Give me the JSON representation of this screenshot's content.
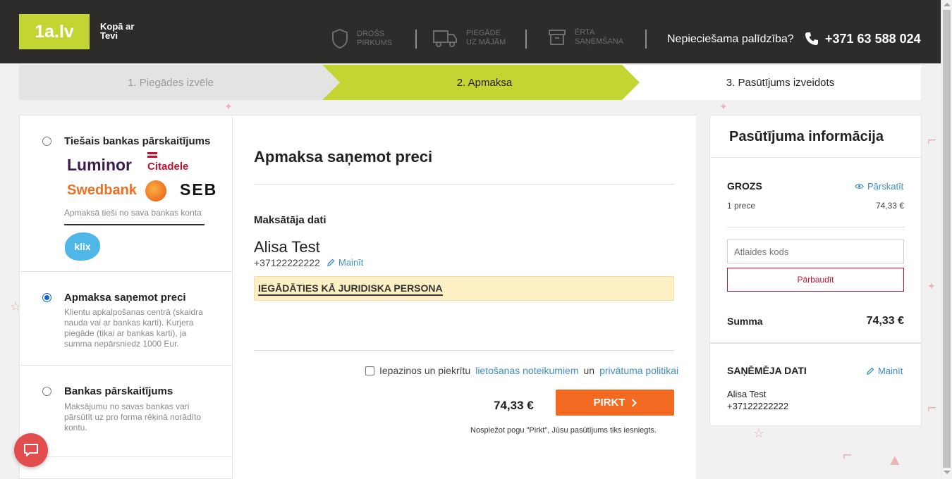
{
  "header": {
    "logo": "1a.lv",
    "slogan": "Kopā ar Tevi",
    "features": [
      {
        "line1": "Drošs",
        "line2": "pirkums",
        "icon": "shield-icon"
      },
      {
        "line1": "Piegāde",
        "line2": "uz mājām",
        "icon": "truck-icon"
      },
      {
        "line1": "Ērta",
        "line2": "saņemšana",
        "icon": "box-icon"
      }
    ],
    "help_text": "Nepieciešama palīdzība?",
    "phone": "+371 63 588 024"
  },
  "steps": [
    {
      "label": "1. Piegādes izvēle",
      "state": "done"
    },
    {
      "label": "2. Apmaksa",
      "state": "active"
    },
    {
      "label": "3. Pasūtījums izveidots",
      "state": "upcoming"
    }
  ],
  "payment_options": [
    {
      "title": "Tiešais bankas pārskaitījums",
      "selected": false,
      "banks": [
        "Luminor",
        "Citadele",
        "Swedbank",
        "SEB"
      ],
      "note": "Apmaksā tieši no sava bankas konta",
      "extra_logo": "klix"
    },
    {
      "title": "Apmaksa saņemot preci",
      "selected": true,
      "description": "Klientu apkalpošanas centrā (skaidra nauda vai ar bankas karti). Kurjera piegāde (tikai ar bankas karti), ja summa nepārsniedz 1000 Eur."
    },
    {
      "title": "Bankas pārskaitījums",
      "selected": false,
      "description": "Maksājumu no savas bankas vari pārsūtīt uz pro forma rēķinā norādīto kontu."
    }
  ],
  "center": {
    "title": "Apmaksa saņemot preci",
    "payer_heading": "Maksātāja dati",
    "payer_name": "Alisa Test",
    "payer_phone": "+37122222222",
    "edit_label": "Mainīt",
    "legal_person": "IEGĀDĀTIES KĀ JURIDISKA PERSONA",
    "terms_prefix": "Iepazinos un piekrītu",
    "terms_link1": "lietošanas noteikumiem",
    "terms_mid": "un",
    "terms_link2": "privātuma politikai",
    "total": "74,33 €",
    "buy_label": "PIRKT",
    "note": "Nospiežot pogu \"Pirkt\", Jūsu pasūtījums tiks iesniegts."
  },
  "order_info": {
    "title": "Pasūtījuma informācija",
    "cart_heading": "GROZS",
    "view_label": "Pārskatīt",
    "items_count": "1 prece",
    "items_price": "74,33 €",
    "discount_placeholder": "Atlaides kods",
    "check_label": "Pārbaudīt",
    "sum_label": "Summa",
    "sum_value": "74,33 €",
    "recipient_heading": "SAŅĒMĒJA DATI",
    "edit_label": "Mainīt",
    "recipient_name": "Alisa Test",
    "recipient_phone": "+37122222222"
  },
  "colors": {
    "brand_green": "#c3d533",
    "buy_orange": "#f26a21",
    "link_blue": "#3f8ec6",
    "check_red": "#c8102e"
  }
}
